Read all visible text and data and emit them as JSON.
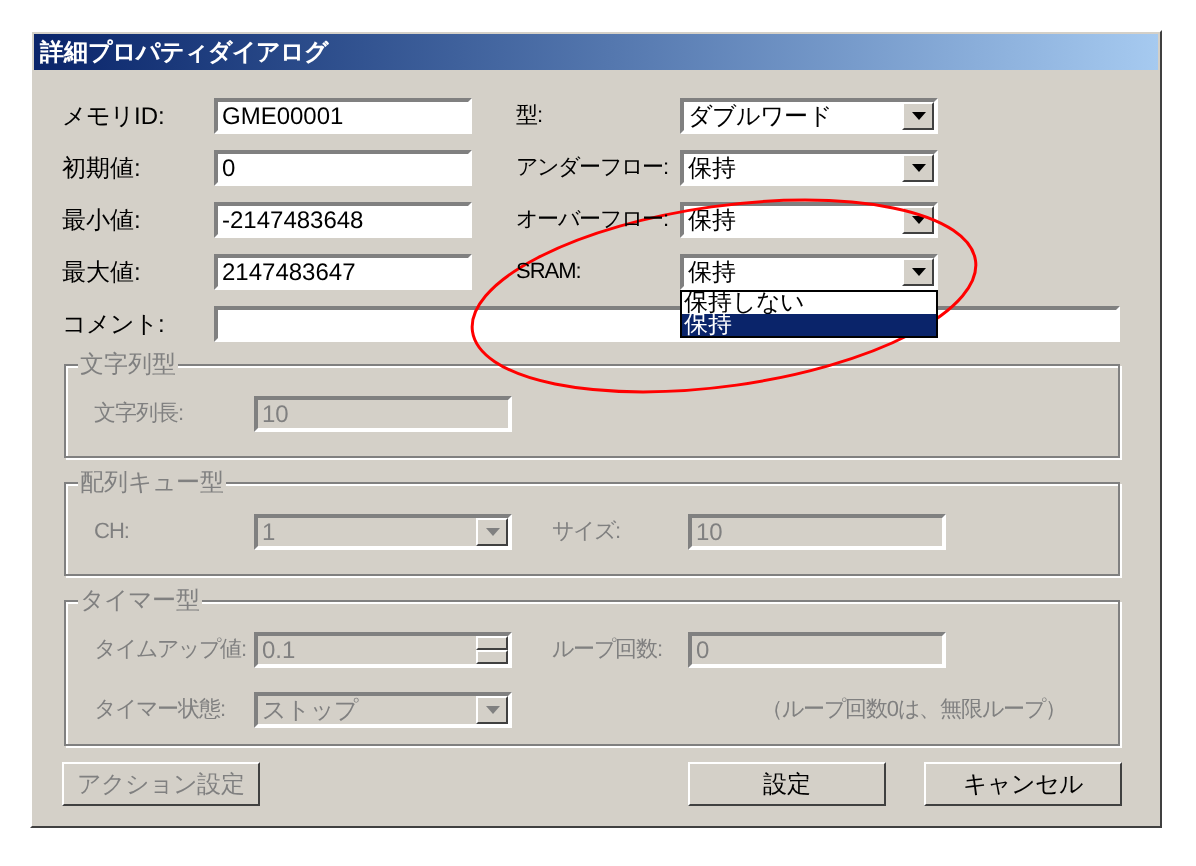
{
  "window": {
    "title": "詳細プロパティダイアログ"
  },
  "rows": [
    {
      "left": {
        "label": "メモリID:",
        "value": "GME00001"
      },
      "right": {
        "label": "型:",
        "value": "ダブルワード"
      }
    },
    {
      "left": {
        "label": "初期値:",
        "value": "0"
      },
      "right": {
        "label": "アンダーフロー:",
        "value": "保持"
      }
    },
    {
      "left": {
        "label": "最小値:",
        "value": "-2147483648"
      },
      "right": {
        "label": "オーバーフロー:",
        "value": "保持"
      }
    },
    {
      "left": {
        "label": "最大値:",
        "value": "2147483647"
      },
      "right": {
        "label": "SRAM:",
        "value": "保持",
        "open": true
      }
    }
  ],
  "comment": {
    "label": "コメント:"
  },
  "dropdown_list": [
    {
      "label": "保持しない",
      "selected": false
    },
    {
      "label": "保持",
      "selected": true
    }
  ],
  "groups": [
    {
      "title": "文字列型",
      "disabled": true,
      "rows": [
        [
          {
            "kind": "text",
            "label": "文字列長:",
            "value": "10"
          }
        ]
      ]
    },
    {
      "title": "配列キュー型",
      "disabled": true,
      "rows": [
        [
          {
            "kind": "select",
            "label": "CH:",
            "value": "1"
          },
          {
            "kind": "text",
            "label": "サイズ:",
            "value": "10"
          }
        ]
      ]
    },
    {
      "title": "タイマー型",
      "disabled": true,
      "rows": [
        [
          {
            "kind": "spinner",
            "label": "タイムアップ値:",
            "value": "0.1"
          },
          {
            "kind": "text",
            "label": "ループ回数:",
            "value": "0"
          }
        ],
        [
          {
            "kind": "select",
            "label": "タイマー状態:",
            "value": "ストップ"
          },
          {
            "kind": "note",
            "label": "（ループ回数0は、無限ループ）"
          }
        ]
      ]
    }
  ],
  "buttons": [
    {
      "label": "アクション設定",
      "disabled": true
    },
    {
      "label": "設定",
      "disabled": false
    },
    {
      "label": "キャンセル",
      "disabled": false
    }
  ]
}
